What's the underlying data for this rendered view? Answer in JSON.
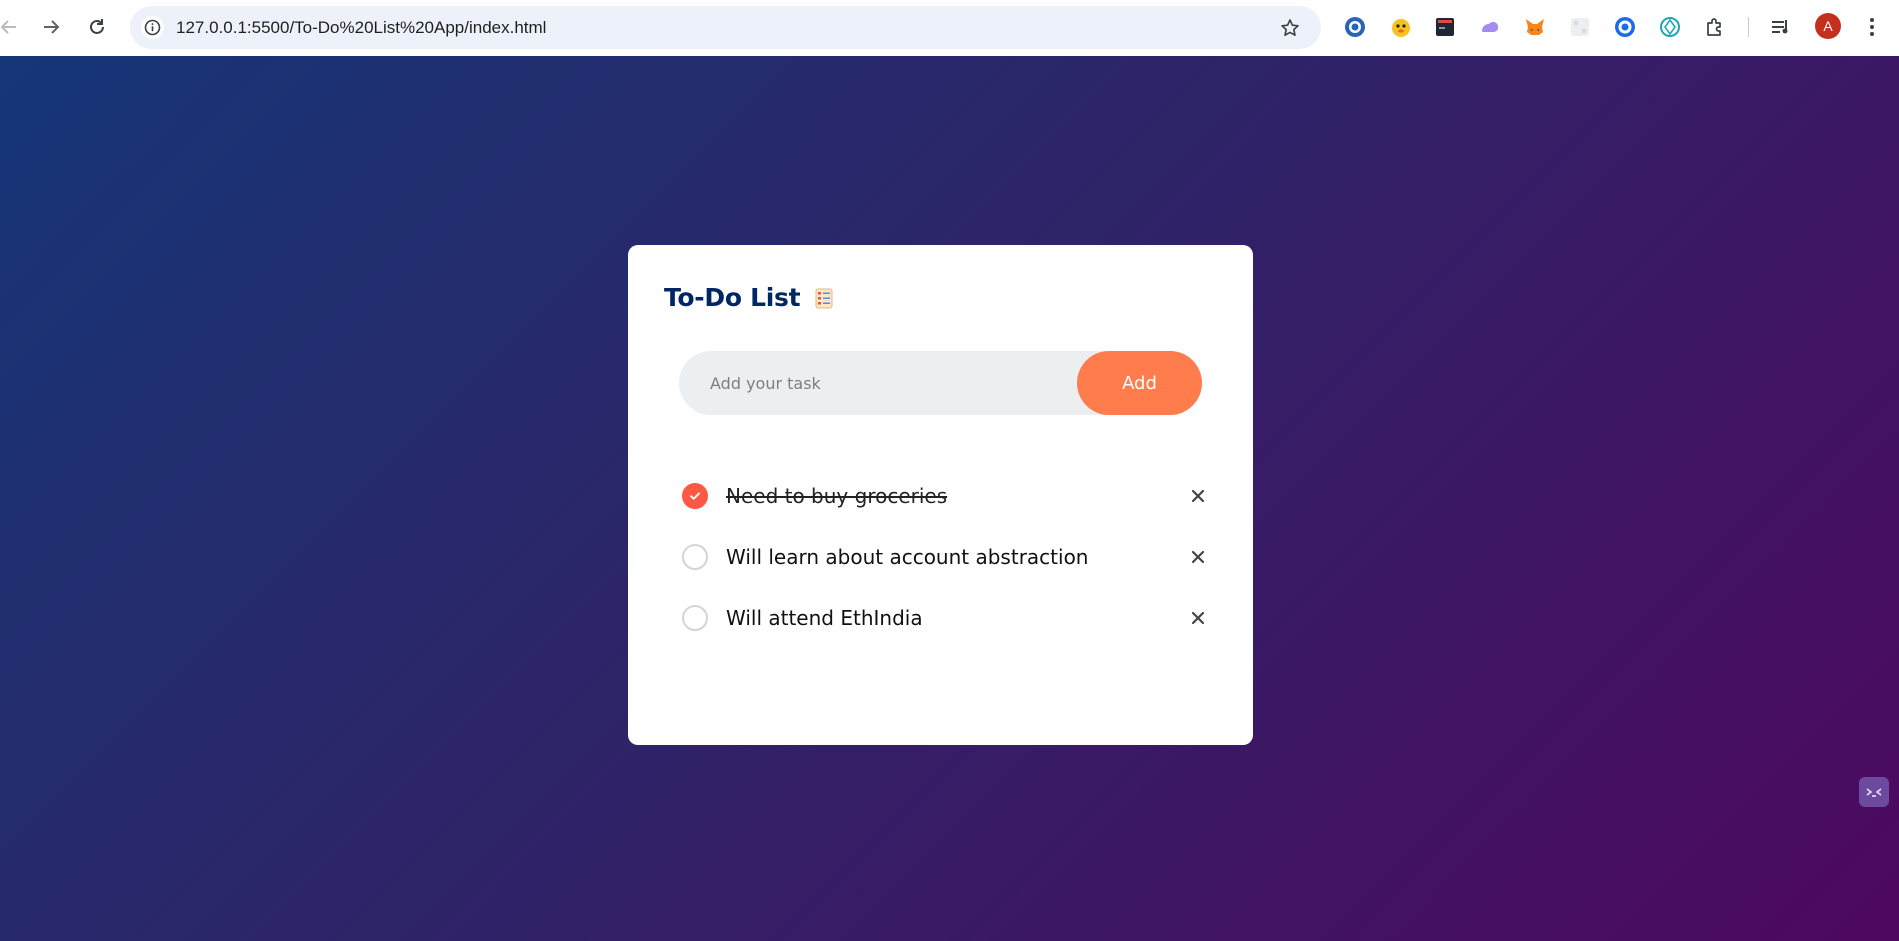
{
  "browser": {
    "url": "127.0.0.1:5500/To-Do%20List%20App/index.html",
    "profile_initial": "A",
    "extensions": [
      "edge-ext-icon",
      "duck-ext-icon",
      "terminal-ext-icon",
      "cloud-ext-icon",
      "metamask-fox-icon",
      "grid-ext-icon",
      "target-ext-icon",
      "crystal-ext-icon",
      "puzzle-extensions-icon",
      "media-queue-icon"
    ]
  },
  "app": {
    "title": "To-Do List",
    "input": {
      "placeholder": "Add your task",
      "value": ""
    },
    "add_label": "Add",
    "tasks": [
      {
        "text": "Need to buy groceries",
        "done": true
      },
      {
        "text": "Will learn about account abstraction",
        "done": false
      },
      {
        "text": "Will attend EthIndia",
        "done": false
      }
    ]
  },
  "colors": {
    "gradient_start": "#153677",
    "gradient_end": "#4e085f",
    "accent": "#ff7c4c",
    "check_done": "#ff5945",
    "title": "#002765"
  }
}
